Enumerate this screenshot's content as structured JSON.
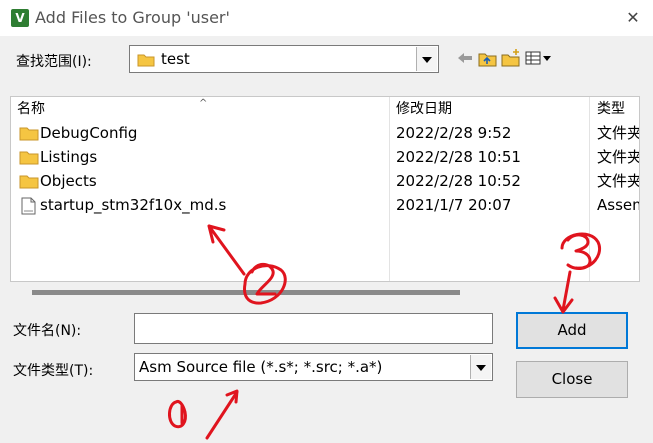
{
  "window": {
    "title": "Add Files to Group 'user'",
    "app_icon": "V",
    "close_glyph": "✕"
  },
  "lookin": {
    "label": "查找范围(I):",
    "value": "test"
  },
  "columns": {
    "name": "名称",
    "date": "修改日期",
    "type": "类型"
  },
  "files": [
    {
      "name": "DebugConfig",
      "date": "2022/2/28 9:52",
      "type": "文件夹",
      "icon": "folder-icon"
    },
    {
      "name": "Listings",
      "date": "2022/2/28 10:51",
      "type": "文件夹",
      "icon": "folder-icon"
    },
    {
      "name": "Objects",
      "date": "2022/2/28 10:52",
      "type": "文件夹",
      "icon": "folder-icon"
    },
    {
      "name": "startup_stm32f10x_md.s",
      "date": "2021/1/7 20:07",
      "type": "Assembler",
      "icon": "asm-file-icon"
    }
  ],
  "filename": {
    "label": "文件名(N):",
    "value": ""
  },
  "filetype": {
    "label": "文件类型(T):",
    "value": "Asm Source file (*.s*; *.src; *.a*)"
  },
  "buttons": {
    "add": "Add",
    "close": "Close"
  },
  "colors": {
    "accent": "#0078d7",
    "folder": "#f5c542",
    "annotation": "#e0141e"
  }
}
